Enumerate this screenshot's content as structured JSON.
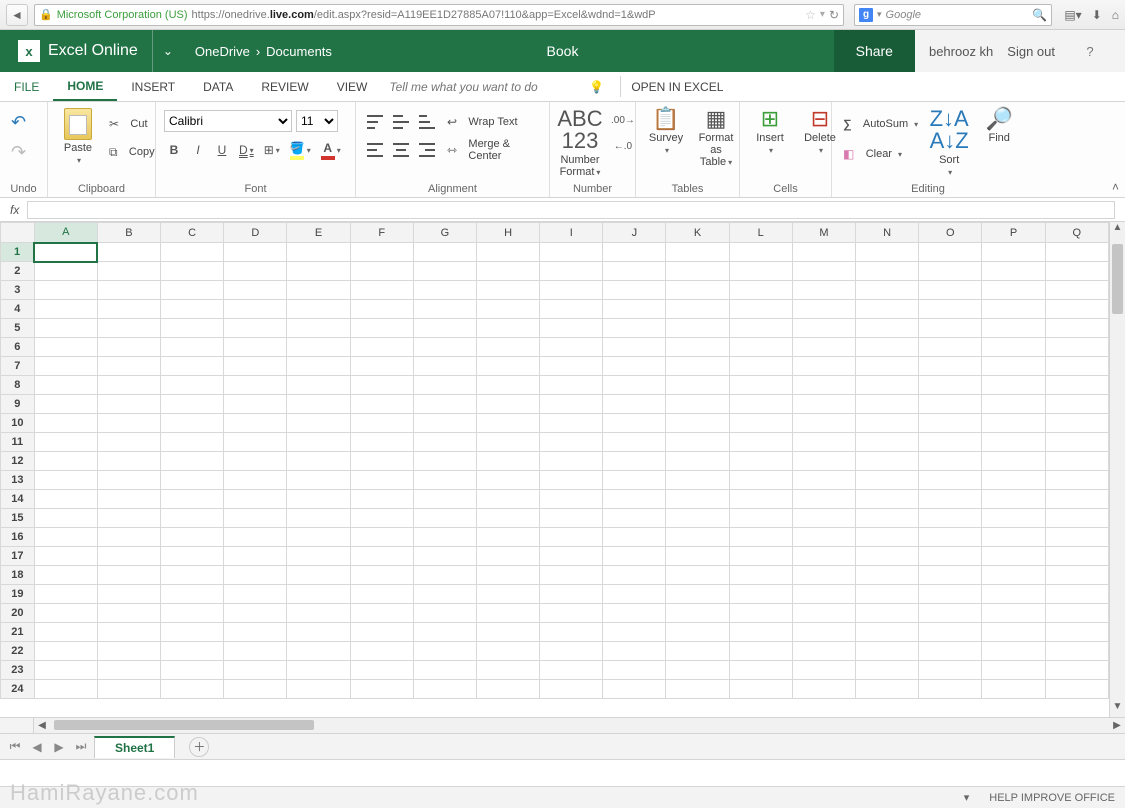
{
  "browser": {
    "cert": "Microsoft Corporation (US)",
    "url_prefix": "https://onedrive.",
    "url_bold": "live.com",
    "url_rest": "/edit.aspx?resid=A119EE1D27885A07!110&app=Excel&wdnd=1&wdP",
    "search_placeholder": "Google"
  },
  "header": {
    "app": "Excel Online",
    "crumb1": "OneDrive",
    "crumb2": "Documents",
    "title": "Book",
    "share": "Share",
    "user": "behrooz kh",
    "signout": "Sign out"
  },
  "tabs": {
    "file": "FILE",
    "home": "HOME",
    "insert": "INSERT",
    "data": "DATA",
    "review": "REVIEW",
    "view": "VIEW",
    "tellme": "Tell me what you want to do",
    "open": "OPEN IN EXCEL"
  },
  "ribbon": {
    "undo": "Undo",
    "clipboard": "Clipboard",
    "paste": "Paste",
    "cut": "Cut",
    "copy": "Copy",
    "font": "Font",
    "font_name": "Calibri",
    "font_size": "11",
    "alignment": "Alignment",
    "wrap": "Wrap Text",
    "merge": "Merge & Center",
    "number": "Number",
    "numfmt": "Number Format",
    "tables": "Tables",
    "survey": "Survey",
    "fmttable": "Format as Table",
    "cells": "Cells",
    "insert": "Insert",
    "delete": "Delete",
    "editing": "Editing",
    "autosum": "AutoSum",
    "clear": "Clear",
    "sort": "Sort",
    "find": "Find"
  },
  "grid": {
    "columns": [
      "A",
      "B",
      "C",
      "D",
      "E",
      "F",
      "G",
      "H",
      "I",
      "J",
      "K",
      "L",
      "M",
      "N",
      "O",
      "P",
      "Q"
    ],
    "rows": 24,
    "active_col": "A",
    "active_row": 1
  },
  "sheets": {
    "active": "Sheet1"
  },
  "status": {
    "help": "HELP IMPROVE OFFICE"
  },
  "watermark": "HamiRayane.com"
}
